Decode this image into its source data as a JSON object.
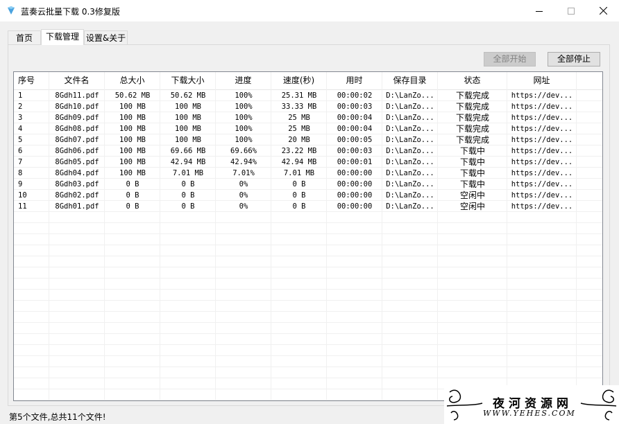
{
  "window": {
    "title": "蓝奏云批量下载 0.3修复版",
    "minimize_icon": "minimize-icon",
    "maximize_icon": "maximize-icon",
    "close_icon": "close-icon"
  },
  "tabs": [
    {
      "label": "首页",
      "active": false
    },
    {
      "label": "下载管理",
      "active": true
    },
    {
      "label": "设置&关于",
      "active": false
    }
  ],
  "toolbar": {
    "start_all_label": "全部开始",
    "start_all_enabled": false,
    "stop_all_label": "全部停止",
    "stop_all_enabled": true
  },
  "table": {
    "columns": [
      "序号",
      "文件名",
      "总大小",
      "下载大小",
      "进度",
      "速度(秒)",
      "用时",
      "保存目录",
      "状态",
      "网址"
    ],
    "rows": [
      [
        "1",
        "8Gdh11.pdf",
        "50.62 MB",
        "50.62 MB",
        "100%",
        "25.31 MB",
        "00:00:02",
        "D:\\LanZo...",
        "下载完成",
        "https://dev..."
      ],
      [
        "2",
        "8Gdh10.pdf",
        "100 MB",
        "100 MB",
        "100%",
        "33.33 MB",
        "00:00:03",
        "D:\\LanZo...",
        "下载完成",
        "https://dev..."
      ],
      [
        "3",
        "8Gdh09.pdf",
        "100 MB",
        "100 MB",
        "100%",
        "25 MB",
        "00:00:04",
        "D:\\LanZo...",
        "下载完成",
        "https://dev..."
      ],
      [
        "4",
        "8Gdh08.pdf",
        "100 MB",
        "100 MB",
        "100%",
        "25 MB",
        "00:00:04",
        "D:\\LanZo...",
        "下载完成",
        "https://dev..."
      ],
      [
        "5",
        "8Gdh07.pdf",
        "100 MB",
        "100 MB",
        "100%",
        "20 MB",
        "00:00:05",
        "D:\\LanZo...",
        "下载完成",
        "https://dev..."
      ],
      [
        "6",
        "8Gdh06.pdf",
        "100 MB",
        "69.66 MB",
        "69.66%",
        "23.22 MB",
        "00:00:03",
        "D:\\LanZo...",
        "下载中",
        "https://dev..."
      ],
      [
        "7",
        "8Gdh05.pdf",
        "100 MB",
        "42.94 MB",
        "42.94%",
        "42.94 MB",
        "00:00:01",
        "D:\\LanZo...",
        "下载中",
        "https://dev..."
      ],
      [
        "8",
        "8Gdh04.pdf",
        "100 MB",
        "7.01 MB",
        "7.01%",
        "7.01 MB",
        "00:00:00",
        "D:\\LanZo...",
        "下载中",
        "https://dev..."
      ],
      [
        "9",
        "8Gdh03.pdf",
        "0 B",
        "0 B",
        "0%",
        "0 B",
        "00:00:00",
        "D:\\LanZo...",
        "下载中",
        "https://dev..."
      ],
      [
        "10",
        "8Gdh02.pdf",
        "0 B",
        "0 B",
        "0%",
        "0 B",
        "00:00:00",
        "D:\\LanZo...",
        "空闲中",
        "https://dev..."
      ],
      [
        "11",
        "8Gdh01.pdf",
        "0 B",
        "0 B",
        "0%",
        "0 B",
        "00:00:00",
        "D:\\LanZo...",
        "空闲中",
        "https://dev..."
      ]
    ]
  },
  "status_bar": {
    "text": "第5个文件,总共11个文件!"
  },
  "watermark": {
    "text": "夜河资源网",
    "url": "WWW.YEHES.COM"
  }
}
